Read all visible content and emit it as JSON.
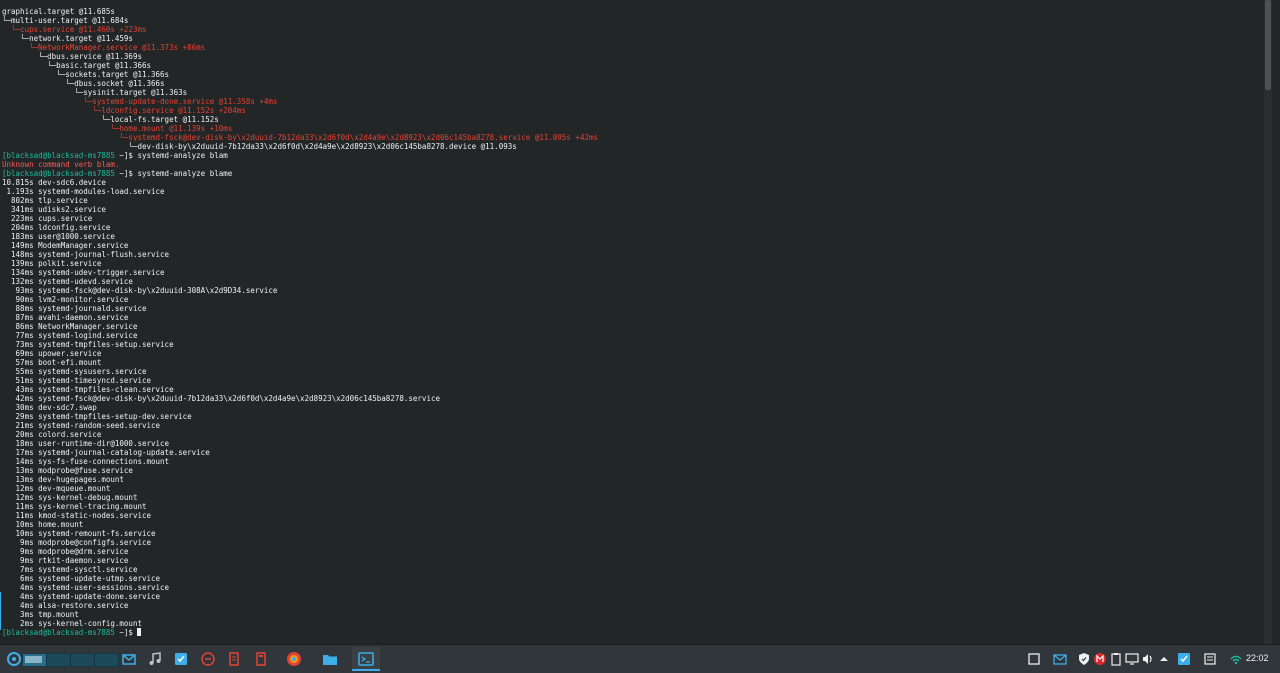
{
  "terminal": {
    "lines": [
      {
        "text": "graphical.target @11.685s",
        "style": "normal"
      },
      {
        "text": "└─multi-user.target @11.684s",
        "style": "normal"
      },
      {
        "text": "  └─cups.service @11.460s +223ms",
        "style": "red"
      },
      {
        "text": "    └─network.target @11.459s",
        "style": "normal"
      },
      {
        "text": "      └─NetworkManager.service @11.373s +86ms",
        "style": "red"
      },
      {
        "text": "        └─dbus.service @11.369s",
        "style": "normal"
      },
      {
        "text": "          └─basic.target @11.366s",
        "style": "normal"
      },
      {
        "text": "            └─sockets.target @11.366s",
        "style": "normal"
      },
      {
        "text": "              └─dbus.socket @11.366s",
        "style": "normal"
      },
      {
        "text": "                └─sysinit.target @11.363s",
        "style": "normal"
      },
      {
        "text": "                  └─systemd-update-done.service @11.358s +4ms",
        "style": "red"
      },
      {
        "text": "                    └─ldconfig.service @11.152s +204ms",
        "style": "red"
      },
      {
        "text": "                      └─local-fs.target @11.152s",
        "style": "normal"
      },
      {
        "text": "                        └─home.mount @11.139s +10ms",
        "style": "red"
      },
      {
        "text": "                          └─systemd-fsck@dev-disk-by\\x2duuid-7b12da33\\x2d6f0d\\x2d4a9e\\x2d8923\\x2d06c145ba8278.service @11.095s +42ms",
        "style": "red"
      },
      {
        "text": "                            └─dev-disk-by\\x2duuid-7b12da33\\x2d6f0d\\x2d4a9e\\x2d8923\\x2d06c145ba8278.device @11.093s",
        "style": "normal"
      },
      {
        "text": "~]$ systemd-analyze blam",
        "style": "prompt",
        "prompt": "[blacksad@blacksad-ms7885 "
      },
      {
        "text": "Unknown command verb blam.",
        "style": "err"
      },
      {
        "text": "~]$ systemd-analyze blame",
        "style": "prompt",
        "prompt": "[blacksad@blacksad-ms7885 "
      },
      {
        "text": "10.815s dev-sdc6.device",
        "style": "normal"
      },
      {
        "text": " 1.193s systemd-modules-load.service",
        "style": "normal"
      },
      {
        "text": "  802ms tlp.service",
        "style": "normal"
      },
      {
        "text": "  341ms udisks2.service",
        "style": "normal"
      },
      {
        "text": "  223ms cups.service",
        "style": "normal"
      },
      {
        "text": "  204ms ldconfig.service",
        "style": "normal"
      },
      {
        "text": "  183ms user@1000.service",
        "style": "normal"
      },
      {
        "text": "  149ms ModemManager.service",
        "style": "normal"
      },
      {
        "text": "  148ms systemd-journal-flush.service",
        "style": "normal"
      },
      {
        "text": "  139ms polkit.service",
        "style": "normal"
      },
      {
        "text": "  134ms systemd-udev-trigger.service",
        "style": "normal"
      },
      {
        "text": "  132ms systemd-udevd.service",
        "style": "normal"
      },
      {
        "text": "   93ms systemd-fsck@dev-disk-by\\x2duuid-308A\\x2d9D34.service",
        "style": "normal"
      },
      {
        "text": "   90ms lvm2-monitor.service",
        "style": "normal"
      },
      {
        "text": "   88ms systemd-journald.service",
        "style": "normal"
      },
      {
        "text": "   87ms avahi-daemon.service",
        "style": "normal"
      },
      {
        "text": "   86ms NetworkManager.service",
        "style": "normal"
      },
      {
        "text": "   77ms systemd-logind.service",
        "style": "normal"
      },
      {
        "text": "   73ms systemd-tmpfiles-setup.service",
        "style": "normal"
      },
      {
        "text": "   69ms upower.service",
        "style": "normal"
      },
      {
        "text": "   57ms boot-efi.mount",
        "style": "normal"
      },
      {
        "text": "   55ms systemd-sysusers.service",
        "style": "normal"
      },
      {
        "text": "   51ms systemd-timesyncd.service",
        "style": "normal"
      },
      {
        "text": "   43ms systemd-tmpfiles-clean.service",
        "style": "normal"
      },
      {
        "text": "   42ms systemd-fsck@dev-disk-by\\x2duuid-7b12da33\\x2d6f0d\\x2d4a9e\\x2d8923\\x2d06c145ba8278.service",
        "style": "normal"
      },
      {
        "text": "   30ms dev-sdc7.swap",
        "style": "normal"
      },
      {
        "text": "   29ms systemd-tmpfiles-setup-dev.service",
        "style": "normal"
      },
      {
        "text": "   21ms systemd-random-seed.service",
        "style": "normal"
      },
      {
        "text": "   20ms colord.service",
        "style": "normal"
      },
      {
        "text": "   18ms user-runtime-dir@1000.service",
        "style": "normal"
      },
      {
        "text": "   17ms systemd-journal-catalog-update.service",
        "style": "normal"
      },
      {
        "text": "   14ms sys-fs-fuse-connections.mount",
        "style": "normal"
      },
      {
        "text": "   13ms modprobe@fuse.service",
        "style": "normal"
      },
      {
        "text": "   13ms dev-hugepages.mount",
        "style": "normal"
      },
      {
        "text": "   12ms dev-mqueue.mount",
        "style": "normal"
      },
      {
        "text": "   12ms sys-kernel-debug.mount",
        "style": "normal"
      },
      {
        "text": "   11ms sys-kernel-tracing.mount",
        "style": "normal"
      },
      {
        "text": "   11ms kmod-static-nodes.service",
        "style": "normal"
      },
      {
        "text": "   10ms home.mount",
        "style": "normal"
      },
      {
        "text": "   10ms systemd-remount-fs.service",
        "style": "normal"
      },
      {
        "text": "    9ms modprobe@configfs.service",
        "style": "normal"
      },
      {
        "text": "    9ms modprobe@drm.service",
        "style": "normal"
      },
      {
        "text": "    9ms rtkit-daemon.service",
        "style": "normal"
      },
      {
        "text": "    7ms systemd-sysctl.service",
        "style": "normal"
      },
      {
        "text": "    6ms systemd-update-utmp.service",
        "style": "normal"
      },
      {
        "text": "    4ms systemd-user-sessions.service",
        "style": "normal"
      },
      {
        "text": "    4ms systemd-update-done.service",
        "style": "normal"
      },
      {
        "text": "    4ms alsa-restore.service",
        "style": "normal"
      },
      {
        "text": "    3ms tmp.mount",
        "style": "normal"
      },
      {
        "text": "    2ms sys-kernel-config.mount",
        "style": "normal"
      },
      {
        "text": "~]$ ",
        "style": "prompt",
        "prompt": "[blacksad@blacksad-ms7885 ",
        "cursor": true
      }
    ],
    "scrollbar_position": 0.0,
    "scrollbar_visible_fraction": 0.14
  },
  "taskbar": {
    "clock": "22:02",
    "pager_desktops": 4,
    "active_desktop": 1,
    "launchers": [
      "kde-menu-icon",
      "mail-icon",
      "music-icon",
      "todo-icon",
      "red-circle-icon",
      "document-icon",
      "calculator-icon"
    ],
    "tasks": [
      {
        "name": "browser-task",
        "icon": "browser-icon",
        "active": false
      },
      {
        "name": "file-manager-task",
        "icon": "folder-icon",
        "active": false
      },
      {
        "name": "terminal-task",
        "icon": "terminal-icon",
        "active": true
      }
    ],
    "tray": [
      "window-icon",
      "mail-icon",
      "shield-icon",
      "mega-icon",
      "clipboard-icon",
      "volume-icon",
      "display-icon",
      "expand-icon",
      "checklist-icon",
      "notes-icon",
      "network-icon"
    ],
    "colors": {
      "accent": "#3daee9",
      "prompt": "#1abc9c",
      "red": "#e34234",
      "background": "#232627",
      "panel": "#31363b"
    }
  }
}
